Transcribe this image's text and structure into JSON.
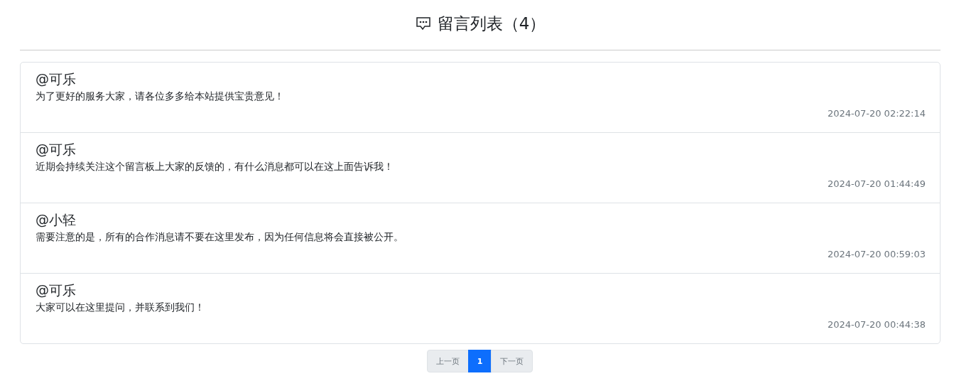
{
  "header": {
    "title": "留言列表（4）"
  },
  "messages": [
    {
      "author": "@可乐",
      "content": "为了更好的服务大家，请各位多多给本站提供宝贵意见！",
      "time": "2024-07-20 02:22:14"
    },
    {
      "author": "@可乐",
      "content": "近期会持续关注这个留言板上大家的反馈的，有什么消息都可以在这上面告诉我！",
      "time": "2024-07-20 01:44:49"
    },
    {
      "author": "@小轻",
      "content": "需要注意的是，所有的合作消息请不要在这里发布，因为任何信息将会直接被公开。",
      "time": "2024-07-20 00:59:03"
    },
    {
      "author": "@可乐",
      "content": "大家可以在这里提问，并联系到我们！",
      "time": "2024-07-20 00:44:38"
    }
  ],
  "pagination": [
    {
      "label": "上一页",
      "selected": false,
      "disabled": true
    },
    {
      "label": "1",
      "selected": true,
      "disabled": false
    },
    {
      "label": "下一页",
      "selected": false,
      "disabled": true
    }
  ]
}
